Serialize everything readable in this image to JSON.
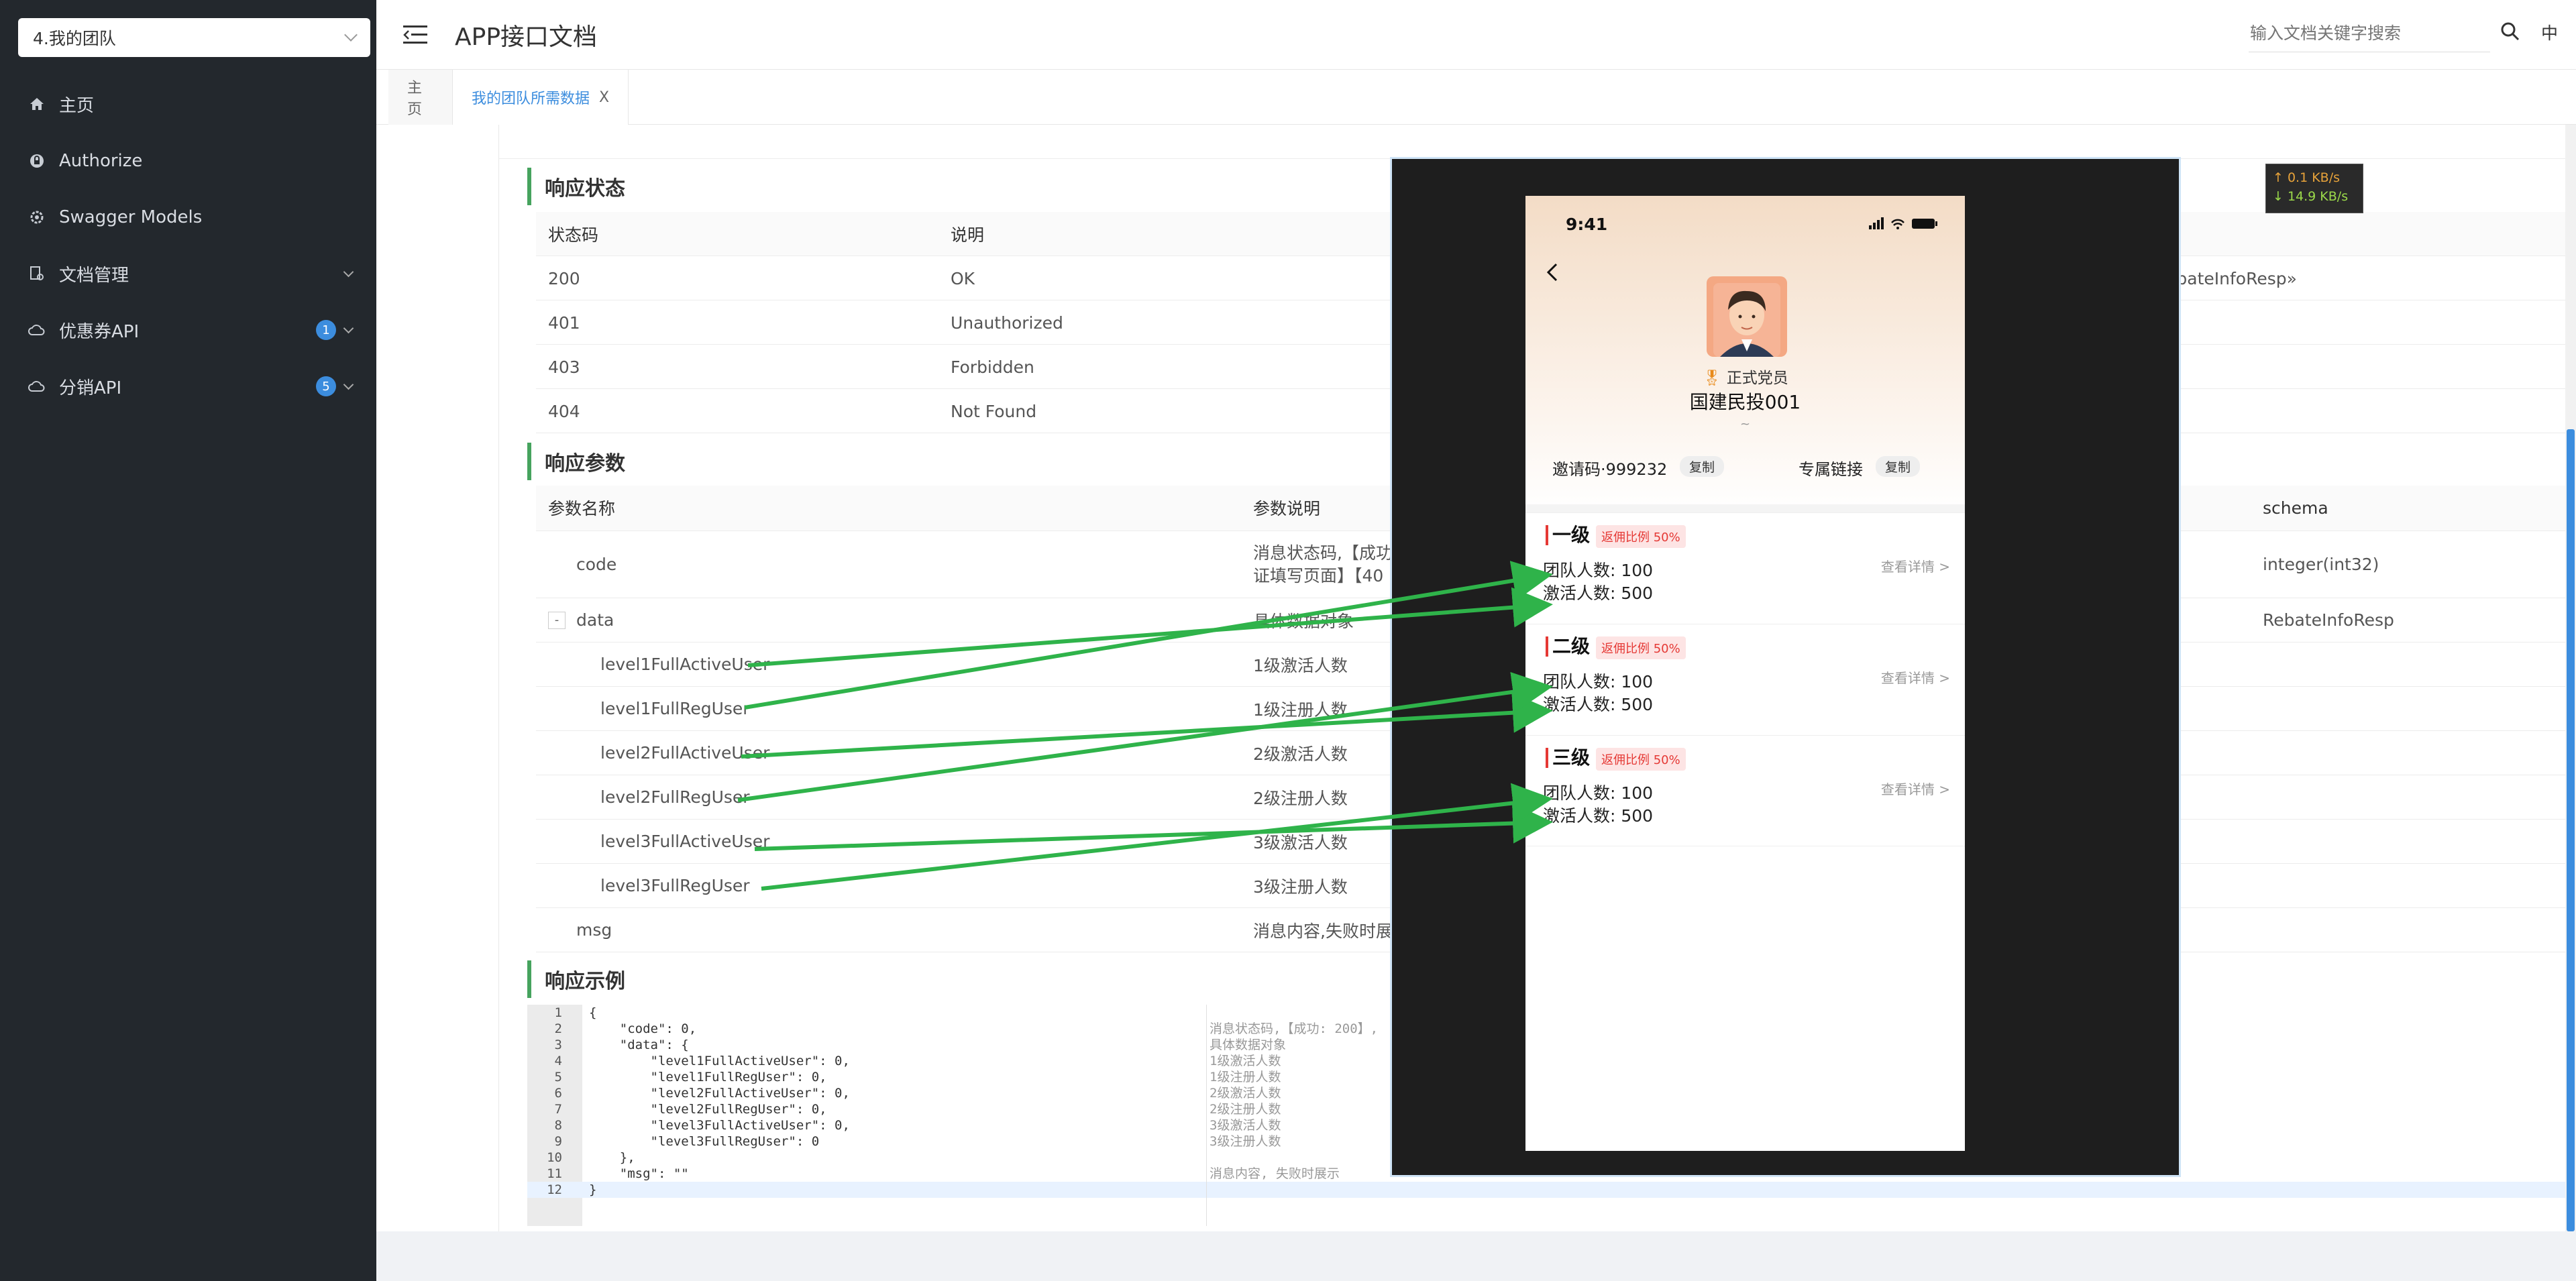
{
  "sidebar": {
    "group_select": "4.我的团队",
    "items": [
      {
        "label": "主页",
        "icon": "home-icon"
      },
      {
        "label": "Authorize",
        "icon": "lock-icon"
      },
      {
        "label": "Swagger Models",
        "icon": "gear-icon"
      },
      {
        "label": "文档管理",
        "icon": "document-icon"
      },
      {
        "label": "优惠券API",
        "icon": "cloud-icon",
        "badge": "1"
      },
      {
        "label": "分销API",
        "icon": "cloud-icon",
        "badge": "5"
      }
    ]
  },
  "header": {
    "title": "APP接口文档",
    "search_placeholder": "输入文档关键字搜索",
    "lang": "中"
  },
  "tabs": [
    {
      "label": "主页",
      "active": false
    },
    {
      "label": "我的团队所需数据",
      "active": true,
      "close": "X"
    }
  ],
  "response_status": {
    "title": "响应状态",
    "columns": [
      "状态码",
      "说明"
    ],
    "schema_fragment": "ebateInfoResp»",
    "rows": [
      {
        "code": "200",
        "desc": "OK"
      },
      {
        "code": "401",
        "desc": "Unauthorized"
      },
      {
        "code": "403",
        "desc": "Forbidden"
      },
      {
        "code": "404",
        "desc": "Not Found"
      }
    ]
  },
  "response_params": {
    "title": "响应参数",
    "columns": [
      "参数名称",
      "参数说明",
      "schema"
    ],
    "collapse_symbol": "-",
    "rows": [
      {
        "name": "code",
        "desc": "消息状态码,【成功",
        "desc2": "证填写页面】【40",
        "schema": "integer(int32)"
      },
      {
        "name": "data",
        "desc": "具体数据对象",
        "schema": "RebateInfoResp"
      },
      {
        "name": "level1FullActiveUser",
        "desc": "1级激活人数",
        "schema": ""
      },
      {
        "name": "level1FullRegUser",
        "desc": "1级注册人数",
        "schema": ""
      },
      {
        "name": "level2FullActiveUser",
        "desc": "2级激活人数",
        "schema": ""
      },
      {
        "name": "level2FullRegUser",
        "desc": "2级注册人数",
        "schema": ""
      },
      {
        "name": "level3FullActiveUser",
        "desc": "3级激活人数",
        "schema": ""
      },
      {
        "name": "level3FullRegUser",
        "desc": "3级注册人数",
        "schema": ""
      },
      {
        "name": "msg",
        "desc": "消息内容,失败时展",
        "schema": ""
      }
    ]
  },
  "response_example": {
    "title": "响应示例",
    "lines": [
      {
        "n": "1",
        "text": "{",
        "comment": ""
      },
      {
        "n": "2",
        "text": "    \"code\": 0,",
        "comment": "消息状态码,【成功: 200】,"
      },
      {
        "n": "3",
        "text": "    \"data\": {",
        "comment": "具体数据对象"
      },
      {
        "n": "4",
        "text": "        \"level1FullActiveUser\": 0,",
        "comment": "1级激活人数"
      },
      {
        "n": "5",
        "text": "        \"level1FullRegUser\": 0,",
        "comment": "1级注册人数"
      },
      {
        "n": "6",
        "text": "        \"level2FullActiveUser\": 0,",
        "comment": "2级激活人数"
      },
      {
        "n": "7",
        "text": "        \"level2FullRegUser\": 0,",
        "comment": "2级注册人数"
      },
      {
        "n": "8",
        "text": "        \"level3FullActiveUser\": 0,",
        "comment": "3级激活人数"
      },
      {
        "n": "9",
        "text": "        \"level3FullRegUser\": 0",
        "comment": "3级注册人数"
      },
      {
        "n": "10",
        "text": "    },",
        "comment": ""
      },
      {
        "n": "11",
        "text": "    \"msg\": \"\"",
        "comment": "消息内容, 失败时展示"
      },
      {
        "n": "12",
        "text": "}",
        "comment": ""
      }
    ]
  },
  "phone": {
    "time": "9:41",
    "member_badge": "正式党员",
    "name": "国建民投001",
    "tilde": "~",
    "invite_label": "邀请码·999232",
    "copy1": "复制",
    "link_label": "专属链接",
    "copy2": "复制",
    "levels": [
      {
        "title": "一级",
        "badge": "返佣比例 50%",
        "team": "团队人数: 100",
        "active": "激活人数: 500",
        "more": "查看详情 >"
      },
      {
        "title": "二级",
        "badge": "返佣比例 50%",
        "team": "团队人数: 100",
        "active": "激活人数: 500",
        "more": "查看详情 >"
      },
      {
        "title": "三级",
        "badge": "返佣比例 50%",
        "team": "团队人数: 100",
        "active": "激活人数: 500",
        "more": "查看详情 >"
      }
    ]
  },
  "speed": {
    "up": "↑ 0.1 KB/s",
    "down": "↓ 14.9 KB/s"
  },
  "colors": {
    "accent": "#3c8dde",
    "section_bar": "#46a35e",
    "arrow": "#2fb34a",
    "sidebar_bg": "#23282d",
    "badge_red": "#e53935"
  }
}
